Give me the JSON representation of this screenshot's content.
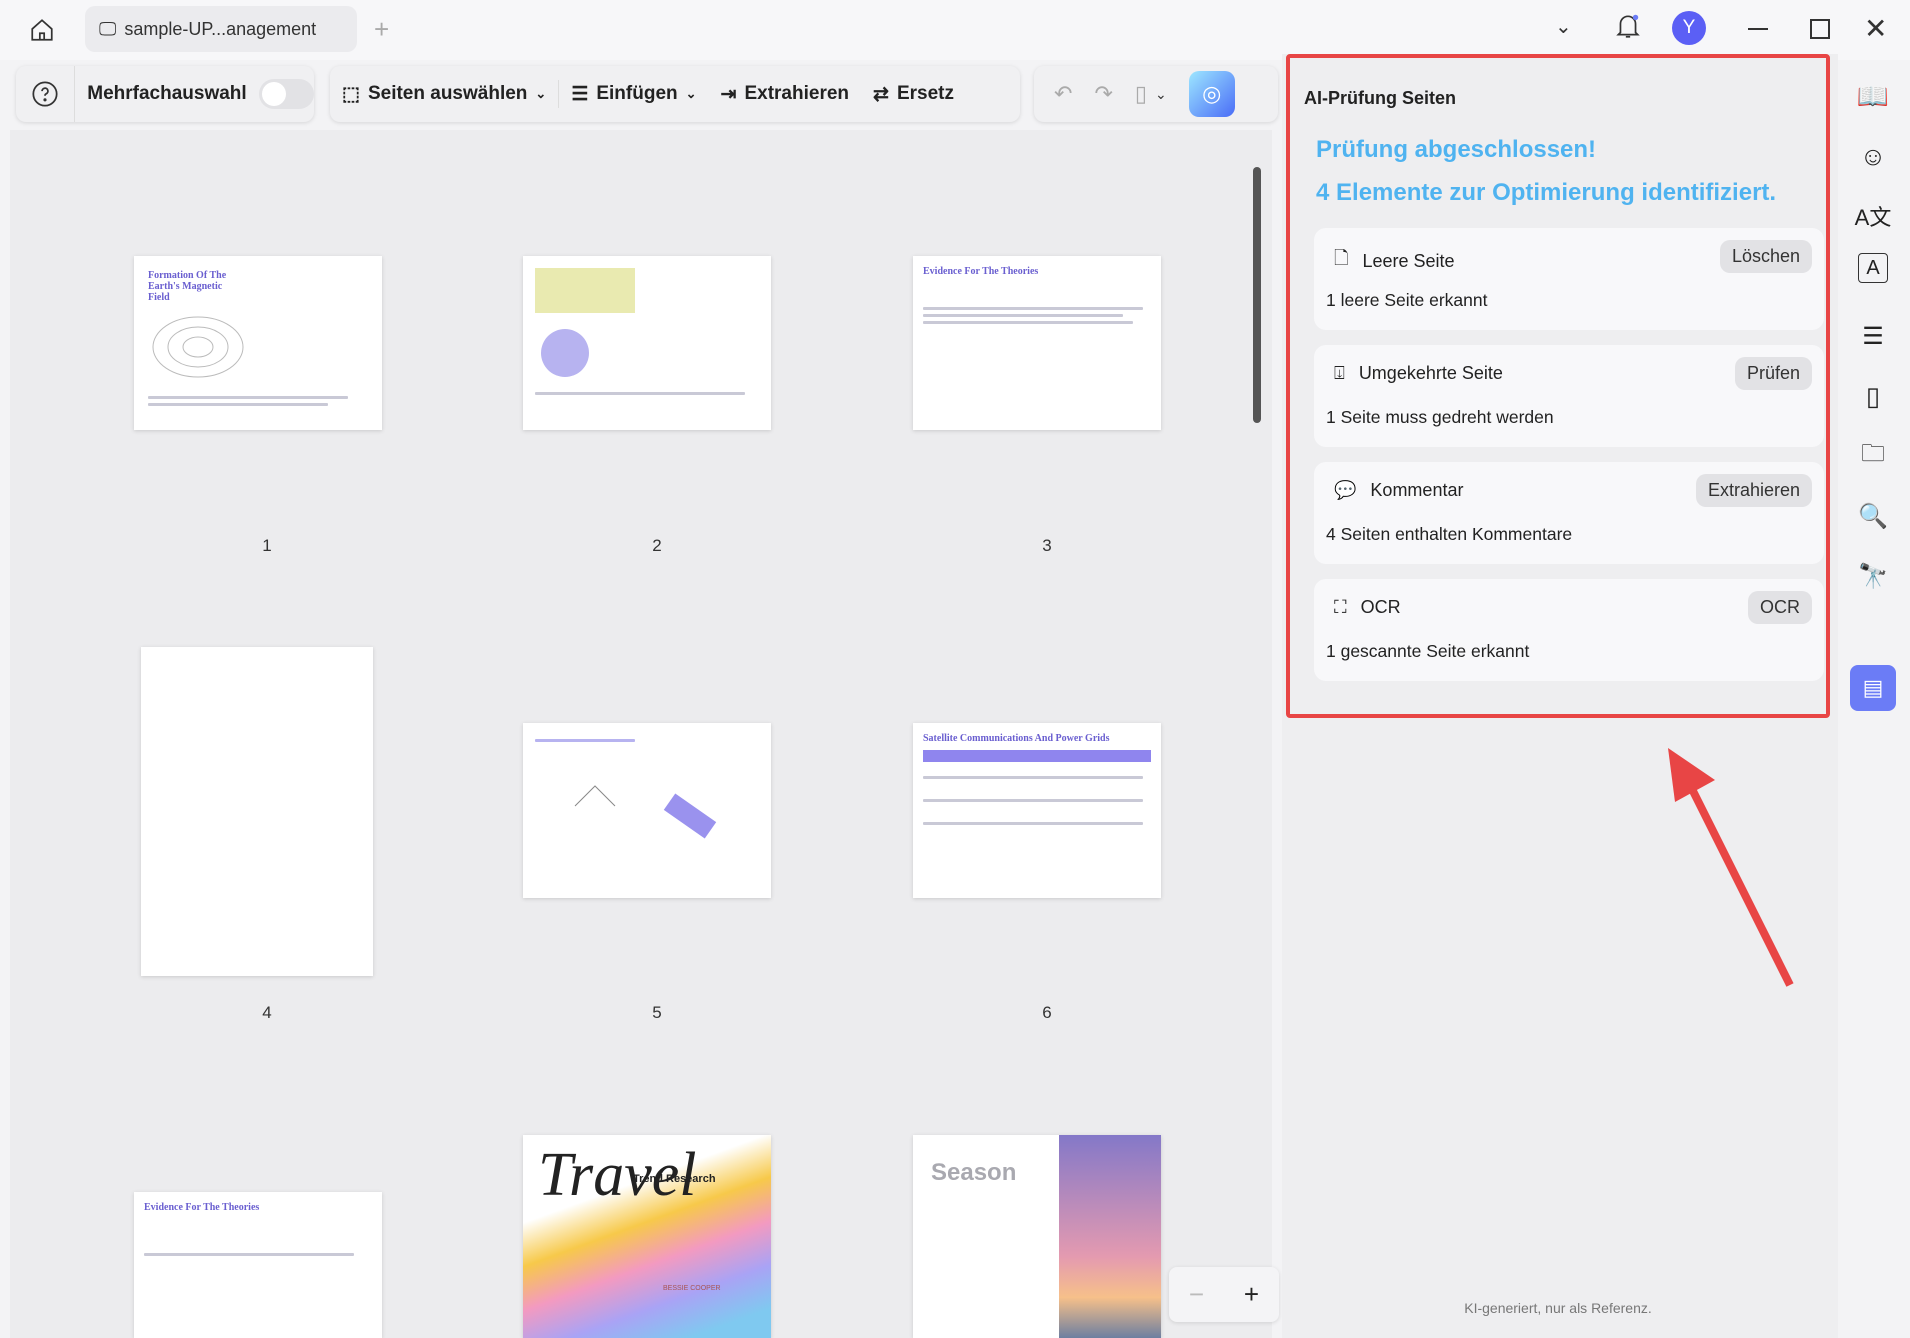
{
  "tab": {
    "title": "sample-UP...anagement"
  },
  "toolbar": {
    "multi": "Mehrfachauswahl",
    "select": "Seiten auswählen",
    "insert": "Einfügen",
    "extract": "Extrahieren",
    "replace": "Ersetz"
  },
  "user": {
    "initial": "Y"
  },
  "pages": [
    {
      "num": "1",
      "title": "Formation Of The Earth's Magnetic Field"
    },
    {
      "num": "2"
    },
    {
      "num": "3",
      "title": "Evidence For The Theories"
    },
    {
      "num": "4"
    },
    {
      "num": "5"
    },
    {
      "num": "6",
      "title": "Satellite Communications And Power Grids"
    },
    {
      "title": "Evidence For The Theories"
    },
    {
      "title": "Travel",
      "subtitle": "Trend Research",
      "author": "BESSIE COOPER"
    },
    {
      "title": "Season"
    }
  ],
  "panel": {
    "title": "AI-Prüfung Seiten",
    "status": "Prüfung abgeschlossen!",
    "summary": "4 Elemente zur Optimierung identifiziert.",
    "items": [
      {
        "label": "Leere Seite",
        "desc": "1 leere Seite erkannt",
        "action": "Löschen"
      },
      {
        "label": "Umgekehrte Seite",
        "desc": "1 Seite muss gedreht werden",
        "action": "Prüfen"
      },
      {
        "label": "Kommentar",
        "desc": "4 Seiten enthalten Kommentare",
        "action": "Extrahieren"
      },
      {
        "label": "OCR",
        "desc": "1 gescannte Seite erkannt",
        "action": "OCR"
      }
    ],
    "footer": "KI-generiert, nur als Referenz."
  },
  "colors": {
    "accent": "#4fb3f0",
    "highlight": "#e84545",
    "rail_active": "#6b7cf6"
  }
}
